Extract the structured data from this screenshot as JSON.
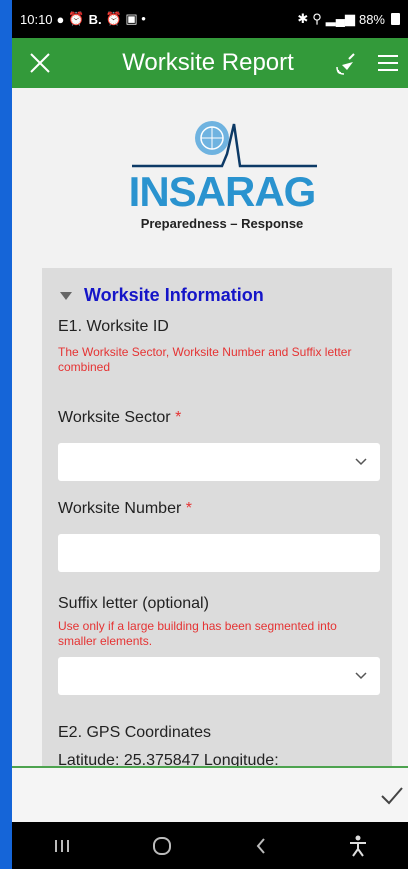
{
  "status_bar": {
    "time": "10:10",
    "notif_b": "B.",
    "battery": "88%"
  },
  "app_bar": {
    "title": "Worksite Report"
  },
  "logo": {
    "word": "INSARAG",
    "tagline": "Preparedness – Response"
  },
  "section": {
    "title": "Worksite Information",
    "e1_label": "E1. Worksite ID",
    "e1_hint": "The Worksite Sector, Worksite Number and Suffix letter combined",
    "sector_label": "Worksite Sector",
    "number_label": "Worksite Number",
    "required_mark": "*",
    "suffix_label": "Suffix letter (optional)",
    "suffix_hint": "Use only if a large building has been segmented into smaller elements.",
    "e2_label": "E2. GPS Coordinates",
    "gps_text": "Latitude: 25.375847 Longitude:"
  },
  "colors": {
    "app_bar": "#339a3a",
    "section_title": "#1515c8",
    "hint": "#e53333",
    "logo": "#2a93cf"
  }
}
